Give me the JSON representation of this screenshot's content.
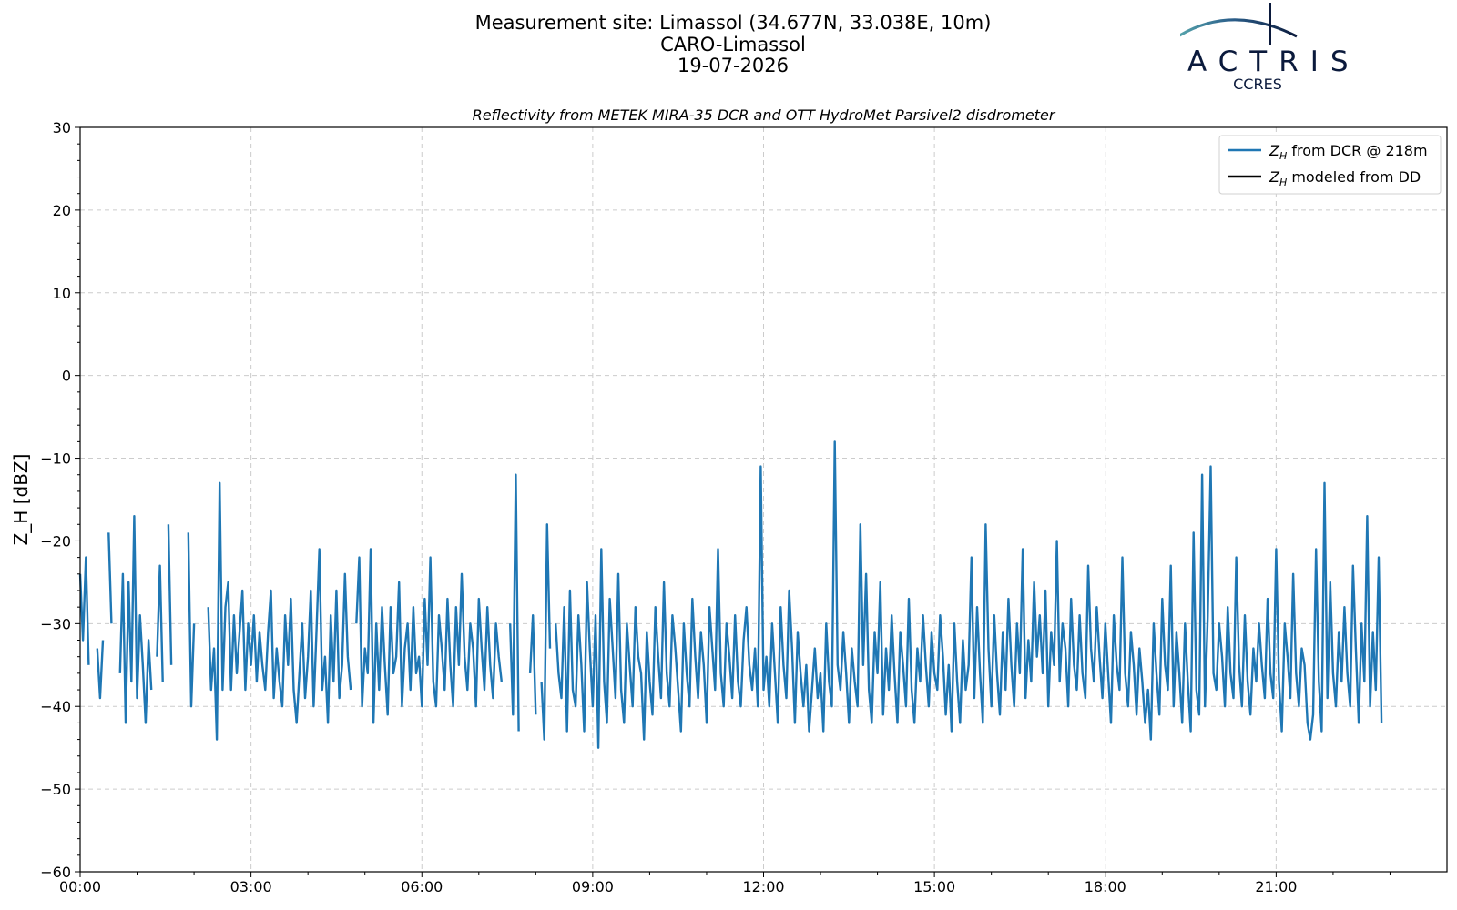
{
  "header": {
    "line1": "Measurement site: Limassol (34.677N, 33.038E, 10m)",
    "line2": "CARO-Limassol",
    "line3": "19-07-2026"
  },
  "logo": {
    "name": "ACTRIS",
    "sub": "CCRES"
  },
  "chart_data": {
    "type": "line",
    "title": "Reflectivity from METEK MIRA-35 DCR and OTT HydroMet Parsivel2 disdrometer",
    "xlabel": "",
    "ylabel": "Z_H [dBZ]",
    "xlim": [
      "00:00",
      "24:00"
    ],
    "ylim": [
      -60,
      30
    ],
    "x_ticks": [
      "00:00",
      "03:00",
      "06:00",
      "09:00",
      "12:00",
      "15:00",
      "18:00",
      "21:00"
    ],
    "y_ticks": [
      30,
      20,
      10,
      0,
      -10,
      -20,
      -30,
      -40,
      -50,
      -60
    ],
    "grid": true,
    "legend_position": "top-right",
    "colors": {
      "dcr": "#1f77b4",
      "dd": "#000000"
    },
    "series": [
      {
        "name": "Z_H from DCR @ 218m",
        "label_main": "Z",
        "label_sub": "H",
        "label_rest": " from DCR @ 218m",
        "x_hours": [
          0.0,
          0.05,
          0.1,
          0.15,
          0.2,
          0.25,
          0.3,
          0.35,
          0.4,
          0.45,
          0.5,
          0.55,
          0.6,
          0.65,
          0.7,
          0.75,
          0.8,
          0.85,
          0.9,
          0.95,
          1.0,
          1.05,
          1.1,
          1.15,
          1.2,
          1.25,
          1.3,
          1.35,
          1.4,
          1.45,
          1.5,
          1.55,
          1.6,
          1.65,
          1.7,
          1.75,
          1.8,
          1.85,
          1.9,
          1.95,
          2.0,
          2.05,
          2.1,
          2.15,
          2.2,
          2.25,
          2.3,
          2.35,
          2.4,
          2.45,
          2.5,
          2.55,
          2.6,
          2.65,
          2.7,
          2.75,
          2.8,
          2.85,
          2.9,
          2.95,
          3.0,
          3.05,
          3.1,
          3.15,
          3.2,
          3.25,
          3.3,
          3.35,
          3.4,
          3.45,
          3.5,
          3.55,
          3.6,
          3.65,
          3.7,
          3.75,
          3.8,
          3.85,
          3.9,
          3.95,
          4.0,
          4.05,
          4.1,
          4.15,
          4.2,
          4.25,
          4.3,
          4.35,
          4.4,
          4.45,
          4.5,
          4.55,
          4.6,
          4.65,
          4.7,
          4.75,
          4.8,
          4.85,
          4.9,
          4.95,
          5.0,
          5.05,
          5.1,
          5.15,
          5.2,
          5.25,
          5.3,
          5.35,
          5.4,
          5.45,
          5.5,
          5.55,
          5.6,
          5.65,
          5.7,
          5.75,
          5.8,
          5.85,
          5.9,
          5.95,
          6.0,
          6.05,
          6.1,
          6.15,
          6.2,
          6.25,
          6.3,
          6.35,
          6.4,
          6.45,
          6.5,
          6.55,
          6.6,
          6.65,
          6.7,
          6.75,
          6.8,
          6.85,
          6.9,
          6.95,
          7.0,
          7.05,
          7.1,
          7.15,
          7.2,
          7.25,
          7.3,
          7.35,
          7.4,
          7.45,
          7.5,
          7.55,
          7.6,
          7.65,
          7.7,
          7.75,
          7.8,
          7.85,
          7.9,
          7.95,
          8.0,
          8.05,
          8.1,
          8.15,
          8.2,
          8.25,
          8.3,
          8.35,
          8.4,
          8.45,
          8.5,
          8.55,
          8.6,
          8.65,
          8.7,
          8.75,
          8.8,
          8.85,
          8.9,
          8.95,
          9.0,
          9.05,
          9.1,
          9.15,
          9.2,
          9.25,
          9.3,
          9.35,
          9.4,
          9.45,
          9.5,
          9.55,
          9.6,
          9.65,
          9.7,
          9.75,
          9.8,
          9.85,
          9.9,
          9.95,
          10.0,
          10.05,
          10.1,
          10.15,
          10.2,
          10.25,
          10.3,
          10.35,
          10.4,
          10.45,
          10.5,
          10.55,
          10.6,
          10.65,
          10.7,
          10.75,
          10.8,
          10.85,
          10.9,
          10.95,
          11.0,
          11.05,
          11.1,
          11.15,
          11.2,
          11.25,
          11.3,
          11.35,
          11.4,
          11.45,
          11.5,
          11.55,
          11.6,
          11.65,
          11.7,
          11.75,
          11.8,
          11.85,
          11.9,
          11.95,
          12.0,
          12.05,
          12.1,
          12.15,
          12.2,
          12.25,
          12.3,
          12.35,
          12.4,
          12.45,
          12.5,
          12.55,
          12.6,
          12.65,
          12.7,
          12.75,
          12.8,
          12.85,
          12.9,
          12.95,
          13.0,
          13.05,
          13.1,
          13.15,
          13.2,
          13.25,
          13.3,
          13.35,
          13.4,
          13.45,
          13.5,
          13.55,
          13.6,
          13.65,
          13.7,
          13.75,
          13.8,
          13.85,
          13.9,
          13.95,
          14.0,
          14.05,
          14.1,
          14.15,
          14.2,
          14.25,
          14.3,
          14.35,
          14.4,
          14.45,
          14.5,
          14.55,
          14.6,
          14.65,
          14.7,
          14.75,
          14.8,
          14.85,
          14.9,
          14.95,
          15.0,
          15.05,
          15.1,
          15.15,
          15.2,
          15.25,
          15.3,
          15.35,
          15.4,
          15.45,
          15.5,
          15.55,
          15.6,
          15.65,
          15.7,
          15.75,
          15.8,
          15.85,
          15.9,
          15.95,
          16.0,
          16.05,
          16.1,
          16.15,
          16.2,
          16.25,
          16.3,
          16.35,
          16.4,
          16.45,
          16.5,
          16.55,
          16.6,
          16.65,
          16.7,
          16.75,
          16.8,
          16.85,
          16.9,
          16.95,
          17.0,
          17.05,
          17.1,
          17.15,
          17.2,
          17.25,
          17.3,
          17.35,
          17.4,
          17.45,
          17.5,
          17.55,
          17.6,
          17.65,
          17.7,
          17.75,
          17.8,
          17.85,
          17.9,
          17.95,
          18.0,
          18.05,
          18.1,
          18.15,
          18.2,
          18.25,
          18.3,
          18.35,
          18.4,
          18.45,
          18.5,
          18.55,
          18.6,
          18.65,
          18.7,
          18.75,
          18.8,
          18.85,
          18.9,
          18.95,
          19.0,
          19.05,
          19.1,
          19.15,
          19.2,
          19.25,
          19.3,
          19.35,
          19.4,
          19.45,
          19.5,
          19.55,
          19.6,
          19.65,
          19.7,
          19.75,
          19.8,
          19.85,
          19.9,
          19.95,
          20.0,
          20.05,
          20.1,
          20.15,
          20.2,
          20.25,
          20.3,
          20.35,
          20.4,
          20.45,
          20.5,
          20.55,
          20.6,
          20.65,
          20.7,
          20.75,
          20.8,
          20.85,
          20.9,
          20.95,
          21.0,
          21.05,
          21.1,
          21.15,
          21.2,
          21.25,
          21.3,
          21.35,
          21.4,
          21.45,
          21.5,
          21.55,
          21.6,
          21.65,
          21.7,
          21.75,
          21.8,
          21.85,
          21.9,
          21.95,
          22.0,
          22.05,
          22.1,
          22.15,
          22.2,
          22.25,
          22.3,
          22.35,
          22.4,
          22.45,
          22.5,
          22.55,
          22.6,
          22.65,
          22.7,
          22.75,
          22.8,
          22.85,
          22.9,
          22.95,
          23.0,
          23.05,
          23.1,
          23.15,
          23.2,
          23.25,
          23.3,
          23.35,
          23.4,
          23.45,
          23.5,
          23.55,
          23.6,
          23.65,
          23.7,
          23.75,
          23.8,
          23.85,
          23.9,
          23.95
        ],
        "values": [
          -24.0,
          -32.0,
          -22.0,
          -35.0,
          null,
          null,
          -33.0,
          -39.0,
          -32.0,
          null,
          -19.0,
          -30.0,
          null,
          null,
          -36.0,
          -24.0,
          -42.0,
          -25.0,
          -37.0,
          -17.0,
          -39.0,
          -29.0,
          -35.0,
          -42.0,
          -32.0,
          -38.0,
          null,
          -34.0,
          -23.0,
          -37.0,
          null,
          -18.0,
          -35.0,
          null,
          null,
          null,
          null,
          null,
          -19.0,
          -40.0,
          -30.0,
          null,
          null,
          null,
          null,
          -28.0,
          -38.0,
          -33.0,
          -44.0,
          -13.0,
          -38.0,
          -28.0,
          -25.0,
          -38.0,
          -29.0,
          -36.0,
          -31.0,
          -26.0,
          -38.0,
          -30.0,
          -35.0,
          -29.0,
          -37.0,
          -31.0,
          -35.0,
          -38.0,
          -31.0,
          -26.0,
          -39.0,
          -33.0,
          -37.0,
          -40.0,
          -29.0,
          -35.0,
          -27.0,
          -38.0,
          -42.0,
          -36.0,
          -30.0,
          -39.0,
          -34.0,
          -26.0,
          -40.0,
          -31.0,
          -21.0,
          -38.0,
          -34.0,
          -42.0,
          -29.0,
          -37.0,
          -26.0,
          -39.0,
          -35.0,
          -24.0,
          -34.0,
          -38.0,
          null,
          -30.0,
          -22.0,
          -40.0,
          -33.0,
          -36.0,
          -21.0,
          -42.0,
          -30.0,
          -38.0,
          -28.0,
          -35.0,
          -41.0,
          -28.0,
          -36.0,
          -34.0,
          -25.0,
          -40.0,
          -33.0,
          -30.0,
          -38.0,
          -28.0,
          -36.0,
          -34.0,
          -40.0,
          -27.0,
          -35.0,
          -22.0,
          -37.0,
          -40.0,
          -29.0,
          -33.0,
          -38.0,
          -27.0,
          -35.0,
          -40.0,
          -28.0,
          -35.0,
          -24.0,
          -34.0,
          -38.0,
          -30.0,
          -33.0,
          -40.0,
          -27.0,
          -33.0,
          -38.0,
          -28.0,
          -35.0,
          -39.0,
          -30.0,
          -34.0,
          -37.0,
          null,
          null,
          -30.0,
          -41.0,
          -12.0,
          -43.0,
          null,
          null,
          null,
          -36.0,
          -29.0,
          -41.0,
          null,
          -37.0,
          -44.0,
          -18.0,
          -33.0,
          null,
          -30.0,
          -36.0,
          -39.0,
          -28.0,
          -43.0,
          -26.0,
          -38.0,
          -40.0,
          -29.0,
          -35.0,
          -43.0,
          -25.0,
          -33.0,
          -40.0,
          -29.0,
          -45.0,
          -21.0,
          -37.0,
          -42.0,
          -27.0,
          -33.0,
          -39.0,
          -24.0,
          -38.0,
          -42.0,
          -30.0,
          -35.0,
          -40.0,
          -28.0,
          -34.0,
          -36.0,
          -44.0,
          -31.0,
          -37.0,
          -41.0,
          -28.0,
          -34.0,
          -39.0,
          -25.0,
          -36.0,
          -40.0,
          -29.0,
          -33.0,
          -38.0,
          -43.0,
          -30.0,
          -36.0,
          -40.0,
          -27.0,
          -34.0,
          -39.0,
          -31.0,
          -35.0,
          -42.0,
          -28.0,
          -33.0,
          -38.0,
          -21.0,
          -36.0,
          -40.0,
          -30.0,
          -34.0,
          -39.0,
          -29.0,
          -37.0,
          -40.0,
          -32.0,
          -28.0,
          -35.0,
          -38.0,
          -33.0,
          -40.0,
          -11.0,
          -38.0,
          -34.0,
          -40.0,
          -30.0,
          -36.0,
          -42.0,
          -28.0,
          -35.0,
          -39.0,
          -26.0,
          -33.0,
          -42.0,
          -31.0,
          -36.0,
          -40.0,
          -35.0,
          -43.0,
          -38.0,
          -33.0,
          -39.0,
          -36.0,
          -43.0,
          -30.0,
          -37.0,
          -40.0,
          -8.0,
          -35.0,
          -38.0,
          -31.0,
          -36.0,
          -42.0,
          -33.0,
          -37.0,
          -40.0,
          -18.0,
          -35.0,
          -24.0,
          -38.0,
          -42.0,
          -31.0,
          -36.0,
          -25.0,
          -41.0,
          -33.0,
          -38.0,
          -29.0,
          -36.0,
          -42.0,
          -31.0,
          -35.0,
          -40.0,
          -27.0,
          -38.0,
          -42.0,
          -33.0,
          -37.0,
          -29.0,
          -35.0,
          -40.0,
          -31.0,
          -36.0,
          -38.0,
          -29.0,
          -34.0,
          -41.0,
          -35.0,
          -43.0,
          -30.0,
          -37.0,
          -42.0,
          -32.0,
          -38.0,
          -35.0,
          -22.0,
          -39.0,
          -28.0,
          -36.0,
          -42.0,
          -18.0,
          -33.0,
          -40.0,
          -29.0,
          -36.0,
          -41.0,
          -31.0,
          -38.0,
          -27.0,
          -35.0,
          -40.0,
          -30.0,
          -36.0,
          -21.0,
          -39.0,
          -32.0,
          -37.0,
          -25.0,
          -34.0,
          -29.0,
          -36.0,
          -26.0,
          -40.0,
          -31.0,
          -35.0,
          -20.0,
          -37.0,
          -30.0,
          -33.0,
          -40.0,
          -27.0,
          -35.0,
          -38.0,
          -29.0,
          -36.0,
          -39.0,
          -23.0,
          -33.0,
          -37.0,
          -28.0,
          -34.0,
          -39.0,
          -30.0,
          -36.0,
          -42.0,
          -29.0,
          -35.0,
          -38.0,
          -22.0,
          -36.0,
          -40.0,
          -31.0,
          -35.0,
          -41.0,
          -33.0,
          -37.0,
          -42.0,
          -38.0,
          -44.0,
          -30.0,
          -36.0,
          -41.0,
          -27.0,
          -35.0,
          -38.0,
          -23.0,
          -40.0,
          -31.0,
          -36.0,
          -42.0,
          -30.0,
          -37.0,
          -43.0,
          -19.0,
          -38.0,
          -41.0,
          -12.0,
          -40.0,
          -29.0,
          -11.0,
          -36.0,
          -38.0,
          -30.0,
          -34.0,
          -40.0,
          -28.0,
          -36.0,
          -39.0,
          -22.0,
          -35.0,
          -40.0,
          -29.0,
          -37.0,
          -41.0,
          -33.0,
          -37.0,
          -30.0,
          -35.0,
          -39.0,
          -27.0,
          -36.0,
          -39.0,
          -21.0,
          -37.0,
          -43.0,
          -30.0,
          -34.0,
          -39.0,
          -24.0,
          -36.0,
          -40.0,
          -33.0,
          -35.0,
          -42.0,
          -44.0,
          -41.0,
          -21.0,
          -37.0,
          -43.0,
          -13.0,
          -39.0,
          -25.0,
          -36.0,
          -40.0,
          -31.0,
          -37.0,
          -28.0,
          -36.0,
          -40.0,
          -23.0,
          -33.0,
          -42.0,
          -30.0,
          -37.0,
          -17.0,
          -40.0,
          -31.0,
          -38.0,
          -22.0,
          -42.0
        ]
      },
      {
        "name": "Z_H modeled from DD",
        "label_main": "Z",
        "label_sub": "H",
        "label_rest": " modeled from DD",
        "values": []
      }
    ]
  }
}
